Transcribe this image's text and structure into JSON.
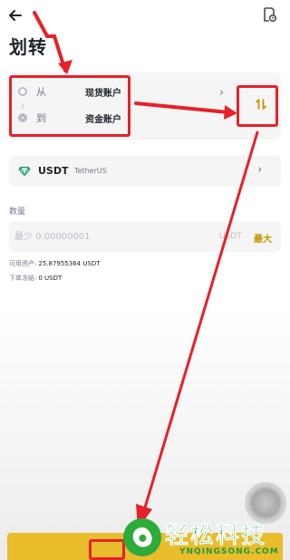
{
  "header": {
    "back_icon": "arrow-left-icon",
    "history_icon": "transfer-history-icon",
    "title": "划转"
  },
  "transfer": {
    "from_label": "从",
    "from_account": "现货账户",
    "to_label": "到",
    "to_account": "资金账户",
    "chevron": "›",
    "swap_icon": "swap-vertical-icon"
  },
  "coin": {
    "icon": "tether-icon",
    "symbol": "USDT",
    "name": "TetherUS",
    "chevron": "›"
  },
  "amount": {
    "label": "数量",
    "placeholder": "最少 0.00000001",
    "value": "",
    "unit": "USDT",
    "max_label": "最大"
  },
  "balances": {
    "available_label": "可用资产:",
    "available_value": "25.87955364 USDT",
    "frozen_label": "下单冻结:",
    "frozen_value": "0 USDT"
  },
  "confirm": {
    "label": ""
  },
  "watermark": {
    "title": "轻松科技",
    "subtitle": "YNQINGSONG.COM"
  },
  "colors": {
    "accent": "#e9bd2c",
    "max_text": "#c99400",
    "annotation_red": "#e8202a",
    "watermark_green": "#1f9a3a"
  }
}
